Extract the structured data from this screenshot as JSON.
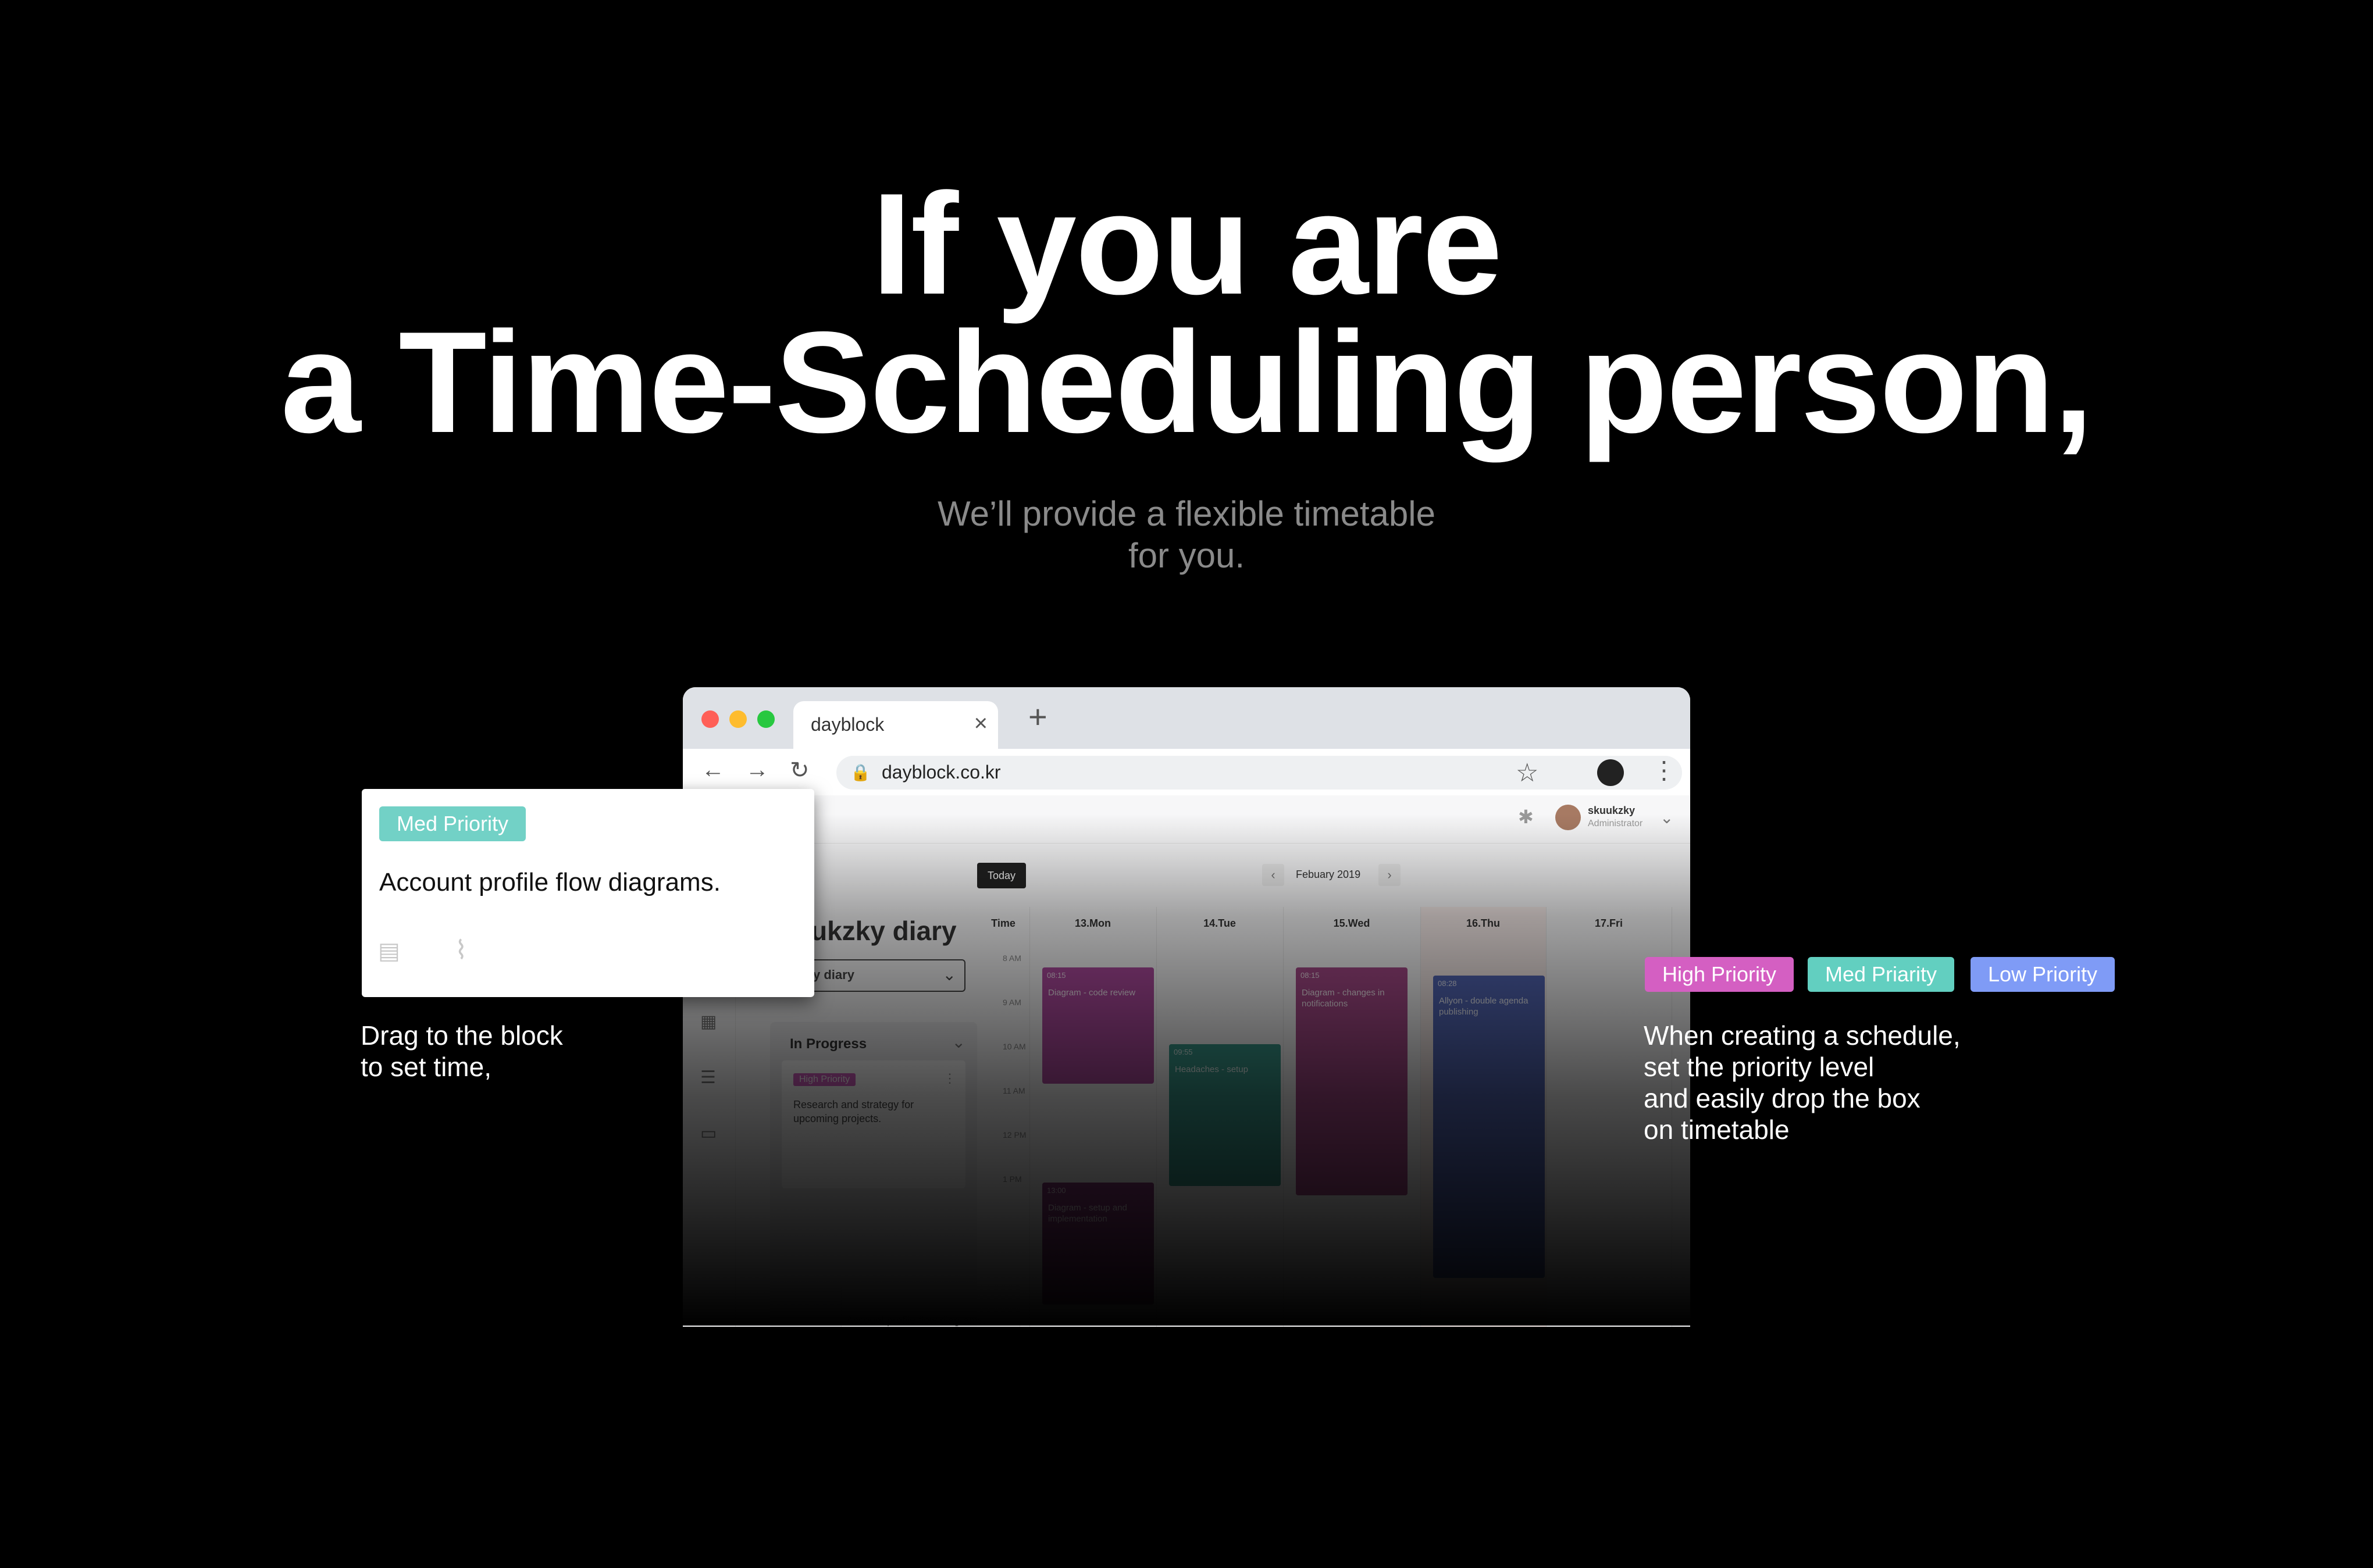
{
  "hero": {
    "line1": "If you are",
    "line2": "a Time-Scheduling person,",
    "sub_line1": "We’ll provide a flexible timetable",
    "sub_line2": "for you."
  },
  "browser": {
    "tab_title": "dayblock",
    "tab_close": "×",
    "new_tab": "+",
    "url": "dayblock.co.kr",
    "icons": {
      "back": "←",
      "forward": "→",
      "reload": "↻",
      "lock": "🔒",
      "star": "☆",
      "menu": "⋮"
    }
  },
  "app": {
    "user": {
      "name": "skuukzky",
      "role": "Administrator"
    },
    "diary_title": "ukzky diary",
    "diary_select": "y diary",
    "today_button": "Today",
    "month": "Febuary 2019",
    "columns": [
      "Time",
      "13.Mon",
      "14.Tue",
      "15.Wed",
      "16.Thu",
      "17.Fri"
    ],
    "times": [
      "8 AM",
      "9 AM",
      "10 AM",
      "11 AM",
      "12 PM",
      "1 PM"
    ],
    "progress": {
      "header": "In Progress",
      "card_tag": "High Priority",
      "card_text": "Research and strategy for upcoming projects.",
      "ghost_text": "Account profile flow diagrams."
    },
    "events": [
      {
        "time": "08:15",
        "desc": "Diagram - code review",
        "color": "#b04ba0"
      },
      {
        "time": "09:55",
        "desc": "Headaches - setup",
        "color": "#3a9c8e"
      },
      {
        "time": "08:15",
        "desc": "Diagram - changes in notifications",
        "color": "#a84a8a"
      },
      {
        "time": "08:28",
        "desc": "Allyon - double agenda publishing",
        "color": "#5468b8"
      },
      {
        "time": "13:00",
        "desc": "Diagram - setup and implementation",
        "color": "#8a3a7e"
      }
    ]
  },
  "float_card": {
    "tag": "Med Priority",
    "text": "Account profile flow diagrams."
  },
  "left_caption": {
    "line1": "Drag to the block",
    "line2": "to set time,"
  },
  "legend": {
    "high": "High Priority",
    "med": "Med Priarity",
    "low": "Low Priority"
  },
  "right_caption": {
    "line1": "When creating a schedule,",
    "line2": "set the priority level",
    "line3": "and easily drop the box",
    "line4": "on timetable"
  },
  "colors": {
    "high": "#d45fc2",
    "med": "#72d1c6",
    "low": "#7f9bf6",
    "background": "#000000"
  }
}
